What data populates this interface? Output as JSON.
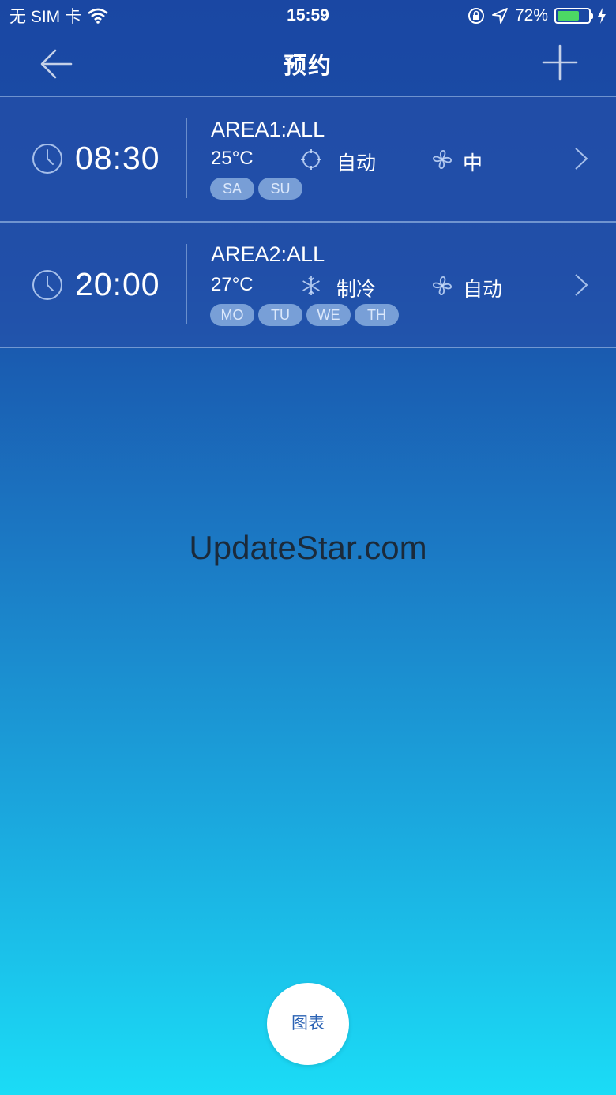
{
  "status_bar": {
    "carrier": "无 SIM 卡",
    "time": "15:59",
    "battery_percent": "72%",
    "battery_level": 0.72,
    "icons": [
      "wifi-icon",
      "orientation-lock-icon",
      "location-arrow-icon",
      "battery-icon",
      "charging-bolt-icon"
    ]
  },
  "nav": {
    "title": "预约",
    "back_icon": "arrow-left-icon",
    "add_icon": "plus-icon"
  },
  "schedules": [
    {
      "time": "08:30",
      "area": "AREA1:ALL",
      "temperature": "25°C",
      "mode_icon": "auto-mode-icon",
      "mode": "自动",
      "fan_icon": "fan-icon",
      "fan": "中",
      "days": [
        "SA",
        "SU"
      ]
    },
    {
      "time": "20:00",
      "area": "AREA2:ALL",
      "temperature": "27°C",
      "mode_icon": "snowflake-icon",
      "mode": "制冷",
      "fan_icon": "fan-icon",
      "fan": "自动",
      "days": [
        "MO",
        "TU",
        "WE",
        "TH"
      ]
    }
  ],
  "watermark": "UpdateStar.com",
  "chart_button": "图表",
  "colors": {
    "background_top": "#1a47a3",
    "background_bottom": "#1bdcf6",
    "battery_fill": "#4cd964",
    "chip_bg": "#96b9e6"
  }
}
